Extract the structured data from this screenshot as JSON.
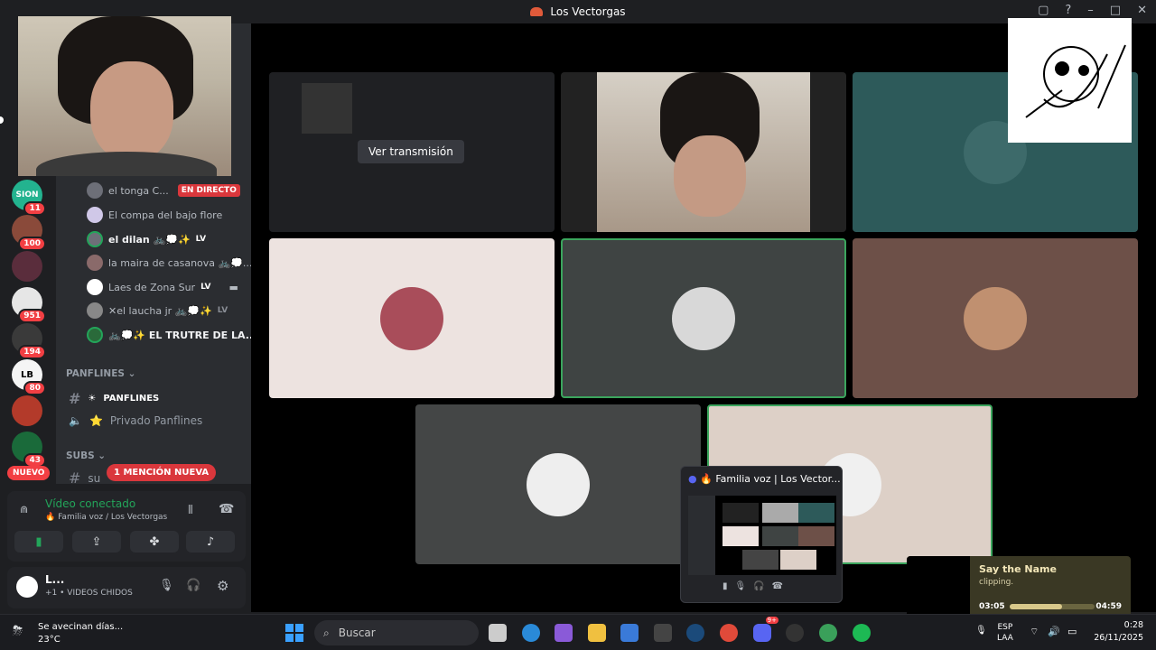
{
  "window": {
    "title": "Los Vectorgas",
    "controls": [
      "▢",
      "?",
      "–",
      "□",
      "✕"
    ]
  },
  "guilds": [
    {
      "label": "SION",
      "badge": "11",
      "color": "#23b38f"
    },
    {
      "label": "",
      "badge": "100",
      "color": "#8a4a3a"
    },
    {
      "label": "",
      "badge": "",
      "color": "#5a2d3c"
    },
    {
      "label": "",
      "badge": "951",
      "color": "#e6e6e6"
    },
    {
      "label": "",
      "badge": "194",
      "color": "#3a3a3a"
    },
    {
      "label": "LB",
      "badge": "80",
      "color": "#f5f5f5"
    },
    {
      "label": "",
      "badge": "",
      "color": "#b33a2a"
    },
    {
      "label": "",
      "badge": "43",
      "color": "#1a6a3a"
    }
  ],
  "guild_new_label": "NUEVO",
  "voice_members": [
    {
      "name": "el tonga C...",
      "tag": "EN DIRECTO",
      "bold": false
    },
    {
      "name": "El compa del bajo flore",
      "tag": "",
      "bold": false
    },
    {
      "name": "el dilan 🚲💭✨",
      "tag": "LV",
      "bold": true
    },
    {
      "name": "la maira de casanova 🚲💭...",
      "tag": "",
      "bold": false
    },
    {
      "name": "Laes de Zona Sur",
      "tag": "LV",
      "bold": false
    },
    {
      "name": "✕el laucha jr 🚲💭✨",
      "tag": "LV",
      "bold": false
    },
    {
      "name": "🚲💭✨ EL TRUTRE DE LA...",
      "tag": "",
      "bold": true
    }
  ],
  "categories": {
    "panflines": "PANFLINES",
    "subs": "SUBS"
  },
  "channels": {
    "panflines_text": "PANFLINES",
    "privado": "Privado Panflines",
    "sub_partial": "su"
  },
  "mention_pill": "1 MENCIÓN NUEVA",
  "voice_panel": {
    "status": "Vídeo conectado",
    "location": "Familia voz / Los Vectorgas"
  },
  "user_panel": {
    "name": "L...",
    "status": "+1 • VIDEOS CHIDOS"
  },
  "stage": {
    "stream_button": "Ver transmisión"
  },
  "mini_call": {
    "title": "Familia voz | Los Vector..."
  },
  "spotify": {
    "track": "Say the Name",
    "artist": "clipping.",
    "elapsed": "03:05",
    "total": "04:59",
    "progress": 0.62
  },
  "taskbar": {
    "weather_title": "Se avecinan días...",
    "weather_temp": "23°C",
    "search_placeholder": "Buscar",
    "discord_badge": "9+",
    "lang_top": "ESP",
    "lang_bottom": "LAA",
    "time": "0:28",
    "date": "26/11/2025"
  },
  "colors": {
    "tile_teal": "#2d5a5a",
    "tile_cream": "#ede3e0",
    "tile_gray": "#3f4443",
    "tile_brown": "#6d5048",
    "tile_dark": "#444646",
    "tile_beige": "#ddd0c7",
    "speaking": "#3ba55d"
  }
}
